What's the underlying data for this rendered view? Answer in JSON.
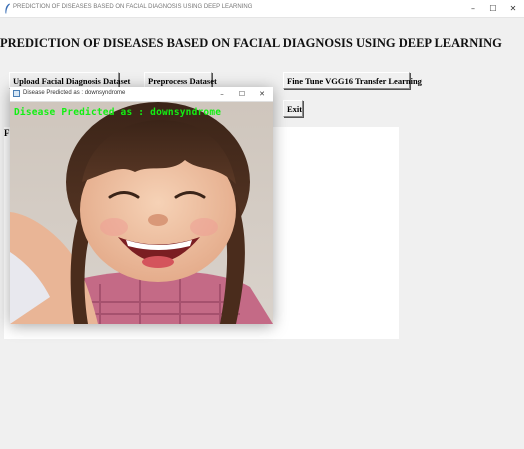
{
  "window": {
    "title": "PREDICTION OF DISEASES BASED ON FACIAL DIAGNOSIS USING DEEP LEARNING",
    "minimize_glyph": "–",
    "maximize_glyph": "☐",
    "close_glyph": "✕"
  },
  "main": {
    "heading": "PREDICTION OF DISEASES BASED ON FACIAL DIAGNOSIS USING DEEP LEARNING",
    "buttons": {
      "upload": "Upload Facial Diagnosis Dataset",
      "preprocess": "Preprocess Dataset",
      "finetune": "Fine Tune VGG16 Transfer Learning",
      "exit": "Exit"
    },
    "text_area_label": "F"
  },
  "popup": {
    "title": "Disease Predicted as : downsyndrome",
    "overlay_text": "Disease Predicted as : downsyndrome",
    "overlay_color": "#12f012",
    "minimize_glyph": "–",
    "maximize_glyph": "☐",
    "close_glyph": "✕"
  }
}
